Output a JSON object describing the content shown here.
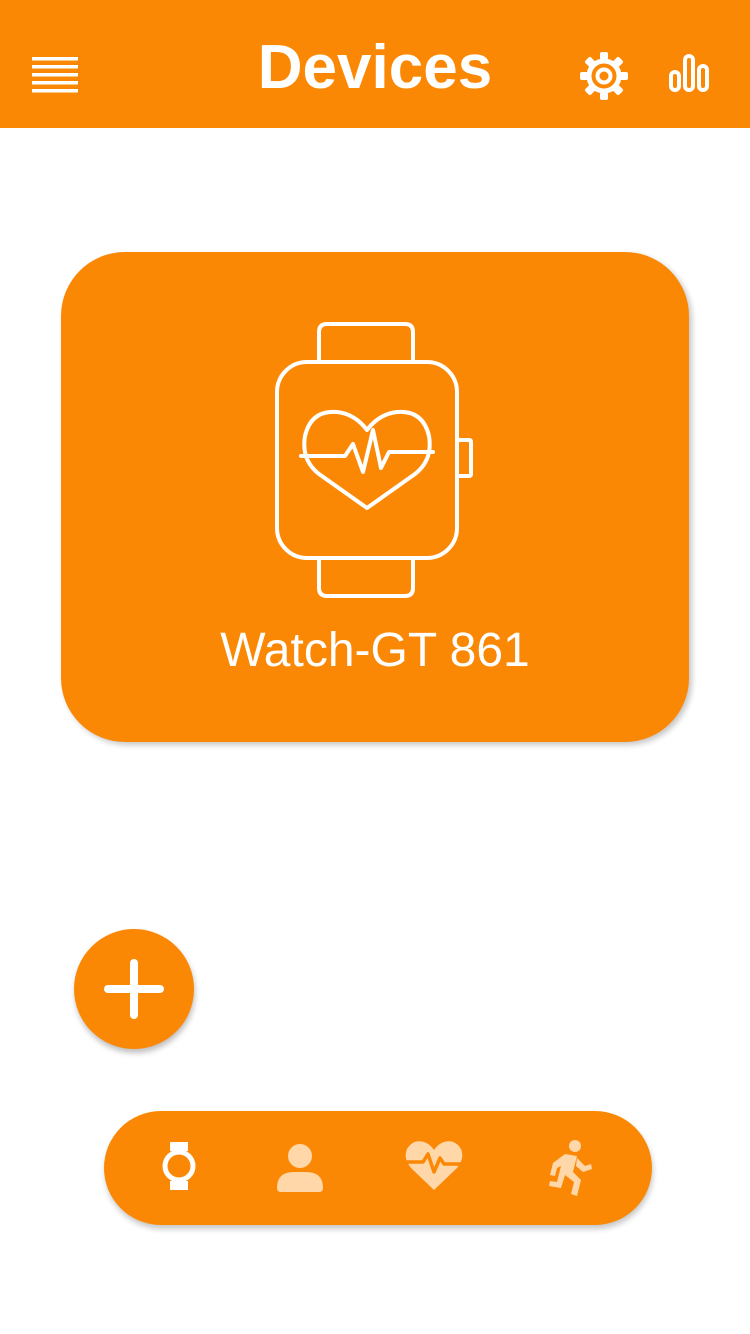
{
  "header": {
    "title": "Devices",
    "menu_icon": "hamburger-menu-icon",
    "settings_icon": "gear-icon",
    "stats_icon": "bar-chart-icon"
  },
  "device": {
    "name": "Watch-GT 861",
    "icon": "smartwatch-heartbeat-icon"
  },
  "add_button": {
    "icon": "plus-icon"
  },
  "bottom_nav": {
    "items": [
      {
        "id": "devices",
        "icon": "watch-icon",
        "active": true
      },
      {
        "id": "profile",
        "icon": "person-icon",
        "active": false
      },
      {
        "id": "health",
        "icon": "heart-rate-icon",
        "active": false
      },
      {
        "id": "activity",
        "icon": "running-icon",
        "active": false
      }
    ]
  },
  "colors": {
    "accent": "#FB8805",
    "icon_active": "#FFFFFF",
    "icon_inactive": "#FFD7A8",
    "background": "#FFFFFF"
  }
}
